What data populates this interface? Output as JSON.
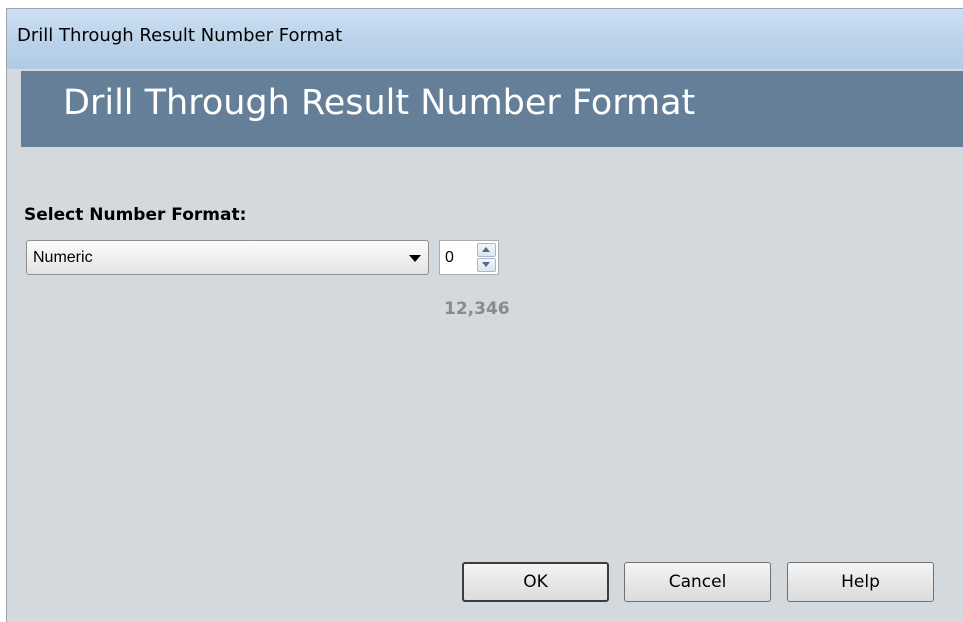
{
  "window": {
    "title": "Drill Through Result Number Format"
  },
  "header": {
    "title": "Drill Through Result Number Format"
  },
  "form": {
    "label": "Select Number Format:",
    "format_select": {
      "value": "Numeric"
    },
    "decimals_spinner": {
      "value": "0"
    },
    "preview": "12,346"
  },
  "buttons": {
    "ok_label": "OK",
    "cancel_label": "Cancel",
    "help_label": "Help"
  }
}
